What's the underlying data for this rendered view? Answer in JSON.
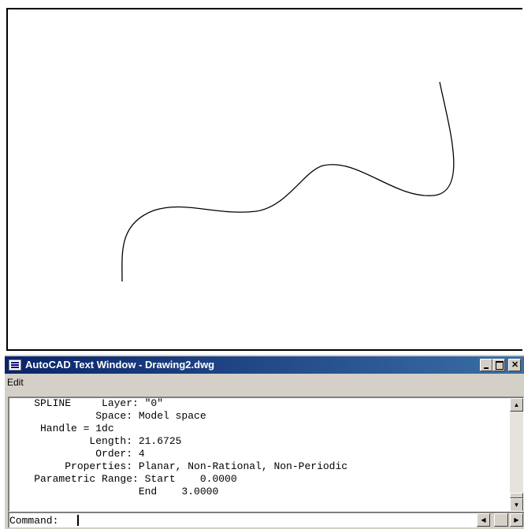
{
  "drawing": {
    "entity": "spline"
  },
  "text_window": {
    "title": "AutoCAD Text Window - Drawing2.dwg",
    "menu": [
      "Edit"
    ],
    "output_lines": [
      "    SPLINE     Layer: \"0\"",
      "              Space: Model space",
      "     Handle = 1dc",
      "             Length: 21.6725",
      "              Order: 4",
      "         Properties: Planar, Non-Rational, Non-Periodic",
      "    Parametric Range: Start    0.0000",
      "                     End    3.0000"
    ],
    "command_prompt": "Command:",
    "command_value": ""
  },
  "icons": {
    "app": "autocad-text-window-icon",
    "minimize": "minimize-icon",
    "maximize": "maximize-icon",
    "close": "close-icon",
    "scroll_up": "arrow-up-icon",
    "scroll_down": "arrow-down-icon",
    "scroll_left": "arrow-left-icon",
    "scroll_right": "arrow-right-icon"
  },
  "colors": {
    "titlebar_start": "#0a246a",
    "titlebar_end": "#3a6ea5",
    "window_bg": "#d4d0c8"
  }
}
